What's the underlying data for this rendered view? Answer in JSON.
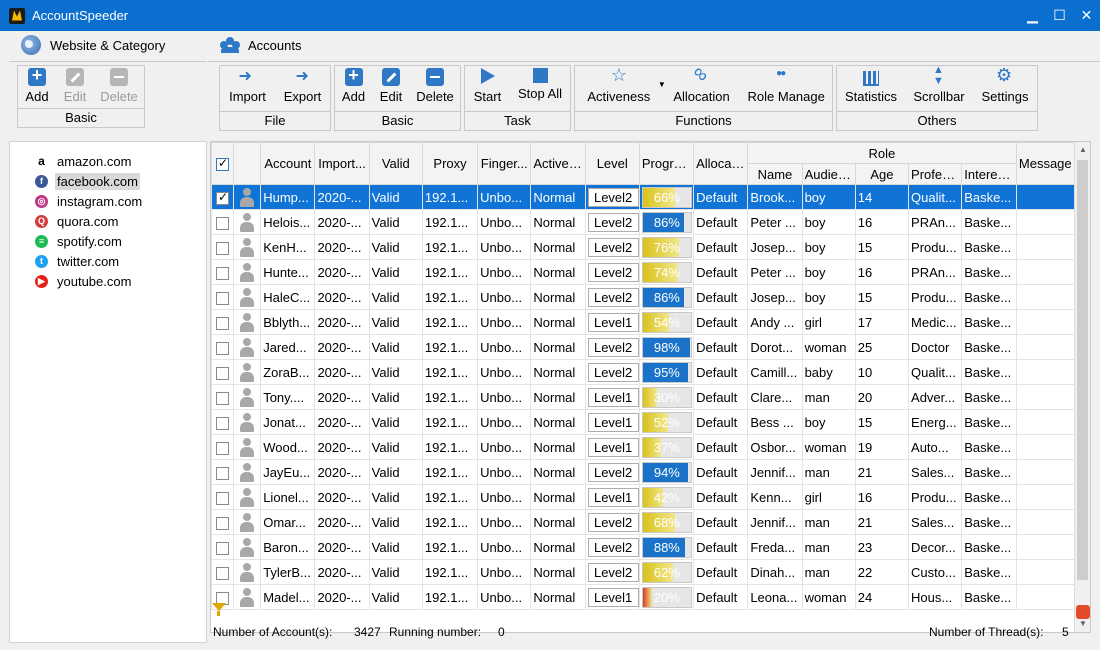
{
  "window": {
    "title": "AccountSpeeder",
    "minimize": "▁",
    "maximize": "☐",
    "close": "✕"
  },
  "left_panel": {
    "header": "Website & Category",
    "group": {
      "label": "Basic",
      "add": "Add",
      "edit": "Edit",
      "delete": "Delete"
    },
    "sites": [
      {
        "label": "amazon.com",
        "icon": "amazon-icon",
        "color": "#ffffff",
        "glyph": "a"
      },
      {
        "label": "facebook.com",
        "icon": "facebook-icon",
        "color": "#3b5998",
        "glyph": "f"
      },
      {
        "label": "instagram.com",
        "icon": "instagram-icon",
        "color": "#c13584",
        "glyph": "◎"
      },
      {
        "label": "quora.com",
        "icon": "quora-icon",
        "color": "#d63a3a",
        "glyph": "Q"
      },
      {
        "label": "spotify.com",
        "icon": "spotify-icon",
        "color": "#1db954",
        "glyph": "≡"
      },
      {
        "label": "twitter.com",
        "icon": "twitter-icon",
        "color": "#1da1f2",
        "glyph": "t"
      },
      {
        "label": "youtube.com",
        "icon": "youtube-icon",
        "color": "#e62117",
        "glyph": "▶"
      }
    ],
    "selected_site": "facebook.com"
  },
  "right_panel": {
    "header": "Accounts",
    "toolbar": {
      "file": {
        "label": "File",
        "import": "Import",
        "export": "Export"
      },
      "basic": {
        "label": "Basic",
        "add": "Add",
        "edit": "Edit",
        "delete": "Delete"
      },
      "task": {
        "label": "Task",
        "start": "Start",
        "stop_all": "Stop All"
      },
      "functions": {
        "label": "Functions",
        "activeness": "Activeness",
        "allocation": "Allocation",
        "role_manage": "Role Manage"
      },
      "others": {
        "label": "Others",
        "statistics": "Statistics",
        "scrollbar": "Scrollbar",
        "settings": "Settings"
      }
    },
    "table": {
      "columns": {
        "account": "Account",
        "import": "Import...",
        "valid": "Valid",
        "proxy": "Proxy",
        "finger": "Finger...",
        "activeness": "Activen...",
        "level": "Level",
        "progress": "Progre...",
        "allocation": "Allocat...",
        "role": "Role",
        "name": "Name",
        "audience": "Audien...",
        "age": "Age",
        "profession": "Profes...",
        "interests": "Interests",
        "message": "Message"
      },
      "rows": [
        {
          "checked": true,
          "account": "Hump...",
          "import": "2020-...",
          "valid": "Valid",
          "proxy": "192.1...",
          "finger": "Unbo...",
          "activeness": "Normal",
          "level": "Level2",
          "progress": 66,
          "progress_text": "66%",
          "allocation": "Default",
          "name": "Brook...",
          "audience": "boy",
          "age": "14",
          "profession": "Qualit...",
          "interests": "Baske..."
        },
        {
          "checked": false,
          "account": "Helois...",
          "import": "2020-...",
          "valid": "Valid",
          "proxy": "192.1...",
          "finger": "Unbo...",
          "activeness": "Normal",
          "level": "Level2",
          "progress": 86,
          "progress_text": "86%",
          "allocation": "Default",
          "name": "Peter ...",
          "audience": "boy",
          "age": "16",
          "profession": "PRAn...",
          "interests": "Baske..."
        },
        {
          "checked": false,
          "account": "KenH...",
          "import": "2020-...",
          "valid": "Valid",
          "proxy": "192.1...",
          "finger": "Unbo...",
          "activeness": "Normal",
          "level": "Level2",
          "progress": 76,
          "progress_text": "76%",
          "allocation": "Default",
          "name": "Josep...",
          "audience": "boy",
          "age": "15",
          "profession": "Produ...",
          "interests": "Baske..."
        },
        {
          "checked": false,
          "account": "Hunte...",
          "import": "2020-...",
          "valid": "Valid",
          "proxy": "192.1...",
          "finger": "Unbo...",
          "activeness": "Normal",
          "level": "Level2",
          "progress": 74,
          "progress_text": "74%",
          "allocation": "Default",
          "name": "Peter ...",
          "audience": "boy",
          "age": "16",
          "profession": "PRAn...",
          "interests": "Baske..."
        },
        {
          "checked": false,
          "account": "HaleC...",
          "import": "2020-...",
          "valid": "Valid",
          "proxy": "192.1...",
          "finger": "Unbo...",
          "activeness": "Normal",
          "level": "Level2",
          "progress": 86,
          "progress_text": "86%",
          "allocation": "Default",
          "name": "Josep...",
          "audience": "boy",
          "age": "15",
          "profession": "Produ...",
          "interests": "Baske..."
        },
        {
          "checked": false,
          "account": "Bblyth...",
          "import": "2020-...",
          "valid": "Valid",
          "proxy": "192.1...",
          "finger": "Unbo...",
          "activeness": "Normal",
          "level": "Level1",
          "progress": 54,
          "progress_text": "54%",
          "allocation": "Default",
          "name": "Andy ...",
          "audience": "girl",
          "age": "17",
          "profession": "Medic...",
          "interests": "Baske..."
        },
        {
          "checked": false,
          "account": "Jared...",
          "import": "2020-...",
          "valid": "Valid",
          "proxy": "192.1...",
          "finger": "Unbo...",
          "activeness": "Normal",
          "level": "Level2",
          "progress": 98,
          "progress_text": "98%",
          "allocation": "Default",
          "name": "Dorot...",
          "audience": "woman",
          "age": "25",
          "profession": "Doctor",
          "interests": "Baske..."
        },
        {
          "checked": false,
          "account": "ZoraB...",
          "import": "2020-...",
          "valid": "Valid",
          "proxy": "192.1...",
          "finger": "Unbo...",
          "activeness": "Normal",
          "level": "Level2",
          "progress": 95,
          "progress_text": "95%",
          "allocation": "Default",
          "name": "Camill...",
          "audience": "baby",
          "age": "10",
          "profession": "Qualit...",
          "interests": "Baske..."
        },
        {
          "checked": false,
          "account": "Tony....",
          "import": "2020-...",
          "valid": "Valid",
          "proxy": "192.1...",
          "finger": "Unbo...",
          "activeness": "Normal",
          "level": "Level1",
          "progress": 30,
          "progress_text": "30%",
          "allocation": "Default",
          "name": "Clare...",
          "audience": "man",
          "age": "20",
          "profession": "Adver...",
          "interests": "Baske..."
        },
        {
          "checked": false,
          "account": "Jonat...",
          "import": "2020-...",
          "valid": "Valid",
          "proxy": "192.1...",
          "finger": "Unbo...",
          "activeness": "Normal",
          "level": "Level1",
          "progress": 52,
          "progress_text": "52%",
          "allocation": "Default",
          "name": "Bess ...",
          "audience": "boy",
          "age": "15",
          "profession": "Energ...",
          "interests": "Baske..."
        },
        {
          "checked": false,
          "account": "Wood...",
          "import": "2020-...",
          "valid": "Valid",
          "proxy": "192.1...",
          "finger": "Unbo...",
          "activeness": "Normal",
          "level": "Level1",
          "progress": 37,
          "progress_text": "37%",
          "allocation": "Default",
          "name": "Osbor...",
          "audience": "woman",
          "age": "19",
          "profession": "Auto...",
          "interests": "Baske..."
        },
        {
          "checked": false,
          "account": "JayEu...",
          "import": "2020-...",
          "valid": "Valid",
          "proxy": "192.1...",
          "finger": "Unbo...",
          "activeness": "Normal",
          "level": "Level2",
          "progress": 94,
          "progress_text": "94%",
          "allocation": "Default",
          "name": "Jennif...",
          "audience": "man",
          "age": "21",
          "profession": "Sales...",
          "interests": "Baske..."
        },
        {
          "checked": false,
          "account": "Lionel...",
          "import": "2020-...",
          "valid": "Valid",
          "proxy": "192.1...",
          "finger": "Unbo...",
          "activeness": "Normal",
          "level": "Level1",
          "progress": 42,
          "progress_text": "42%",
          "allocation": "Default",
          "name": "Kenn...",
          "audience": "girl",
          "age": "16",
          "profession": "Produ...",
          "interests": "Baske..."
        },
        {
          "checked": false,
          "account": "Omar...",
          "import": "2020-...",
          "valid": "Valid",
          "proxy": "192.1...",
          "finger": "Unbo...",
          "activeness": "Normal",
          "level": "Level2",
          "progress": 68,
          "progress_text": "68%",
          "allocation": "Default",
          "name": "Jennif...",
          "audience": "man",
          "age": "21",
          "profession": "Sales...",
          "interests": "Baske..."
        },
        {
          "checked": false,
          "account": "Baron...",
          "import": "2020-...",
          "valid": "Valid",
          "proxy": "192.1...",
          "finger": "Unbo...",
          "activeness": "Normal",
          "level": "Level2",
          "progress": 88,
          "progress_text": "88%",
          "allocation": "Default",
          "name": "Freda...",
          "audience": "man",
          "age": "23",
          "profession": "Decor...",
          "interests": "Baske..."
        },
        {
          "checked": false,
          "account": "TylerB...",
          "import": "2020-...",
          "valid": "Valid",
          "proxy": "192.1...",
          "finger": "Unbo...",
          "activeness": "Normal",
          "level": "Level2",
          "progress": 62,
          "progress_text": "62%",
          "allocation": "Default",
          "name": "Dinah...",
          "audience": "man",
          "age": "22",
          "profession": "Custo...",
          "interests": "Baske..."
        },
        {
          "checked": false,
          "account": "Madel...",
          "import": "2020-...",
          "valid": "Valid",
          "proxy": "192.1...",
          "finger": "Unbo...",
          "activeness": "Normal",
          "level": "Level1",
          "progress": 20,
          "progress_text": "20%",
          "allocation": "Default",
          "name": "Leona...",
          "audience": "woman",
          "age": "24",
          "profession": "Hous...",
          "interests": "Baske..."
        }
      ]
    },
    "status": {
      "account_count_label": "Number of Account(s):",
      "account_count": "3427",
      "running_label": "Running number:",
      "running": "0",
      "threads_label": "Number of Thread(s):",
      "threads": "5"
    }
  },
  "colors": {
    "titlebar": "#0b6fd0",
    "selected_row": "#0f74d6",
    "progress_high": "#1a73c8",
    "progress_mid": "#d9c21a",
    "progress_low": "#d83a2a"
  }
}
